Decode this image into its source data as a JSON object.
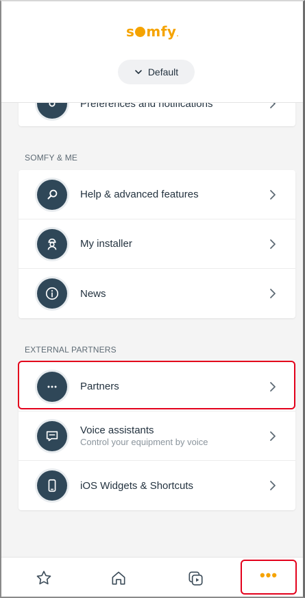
{
  "header": {
    "brand": "somfy",
    "house_selector": "Default"
  },
  "partial_item": {
    "label": "Preferences and notifications"
  },
  "sections": [
    {
      "title": "SOMFY & ME",
      "items": [
        {
          "label": "Help & advanced features",
          "icon": "search-icon"
        },
        {
          "label": "My installer",
          "icon": "installer-icon"
        },
        {
          "label": "News",
          "icon": "info-icon"
        }
      ]
    },
    {
      "title": "EXTERNAL PARTNERS",
      "items": [
        {
          "label": "Partners",
          "icon": "more-dots-icon"
        },
        {
          "label": "Voice assistants",
          "subtitle": "Control your equipment by voice",
          "icon": "chat-bubble-icon"
        },
        {
          "label": "iOS Widgets & Shortcuts",
          "icon": "phone-icon"
        }
      ]
    }
  ],
  "tabbar": {
    "tabs": [
      "star-icon",
      "home-icon",
      "scenarios-play-icon",
      "more-dots-icon"
    ],
    "active": "more-dots-icon",
    "more_label": "•••"
  },
  "colors": {
    "accent": "#f5a300",
    "icon_bg": "#2f4758",
    "highlight": "#e3001b"
  }
}
